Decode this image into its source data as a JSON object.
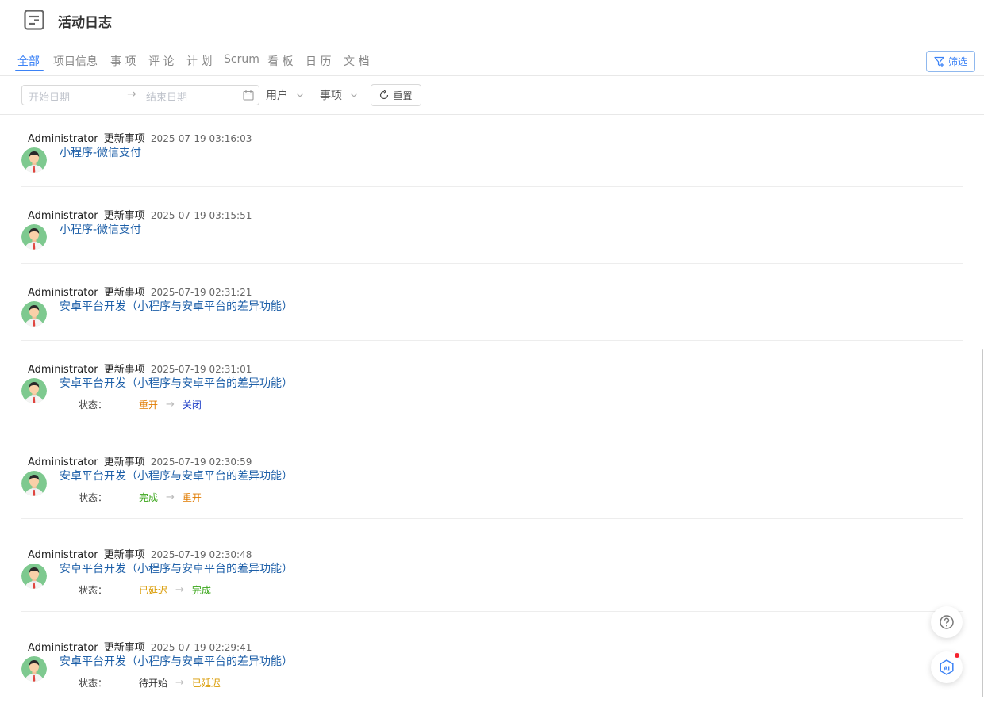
{
  "header": {
    "title": "活动日志"
  },
  "tabs": [
    {
      "label": "全部",
      "active": true
    },
    {
      "label": "项目信息"
    },
    {
      "label": "事 项"
    },
    {
      "label": "评 论"
    },
    {
      "label": "计 划"
    },
    {
      "label": "Scrum"
    },
    {
      "label": "看 板"
    },
    {
      "label": "日 历"
    },
    {
      "label": "文 档"
    }
  ],
  "filter_button": "筛选",
  "toolbar": {
    "start_placeholder": "开始日期",
    "end_placeholder": "结束日期",
    "user_select": "用户",
    "item_select": "事项",
    "reset_label": "重置"
  },
  "colors": {
    "accent": "#3b82f6",
    "link": "#1d5fa8",
    "status_reopen": "#e07b00",
    "status_closed": "#2040c8",
    "status_done": "#3aa61a",
    "status_delayed": "#d99a00",
    "status_pending": "#333333"
  },
  "entries": [
    {
      "user": "Administrator",
      "action": "更新事项",
      "time": "2025-07-19 03:16:03",
      "title": "小程序-微信支付"
    },
    {
      "user": "Administrator",
      "action": "更新事项",
      "time": "2025-07-19 03:15:51",
      "title": "小程序-微信支付"
    },
    {
      "user": "Administrator",
      "action": "更新事项",
      "time": "2025-07-19 02:31:21",
      "title": "安卓平台开发（小程序与安卓平台的差异功能）"
    },
    {
      "user": "Administrator",
      "action": "更新事项",
      "time": "2025-07-19 02:31:01",
      "title": "安卓平台开发（小程序与安卓平台的差异功能）",
      "status_label": "状态：",
      "from": "重开",
      "to": "关闭"
    },
    {
      "user": "Administrator",
      "action": "更新事项",
      "time": "2025-07-19 02:30:59",
      "title": "安卓平台开发（小程序与安卓平台的差异功能）",
      "status_label": "状态：",
      "from": "完成",
      "to": "重开"
    },
    {
      "user": "Administrator",
      "action": "更新事项",
      "time": "2025-07-19 02:30:48",
      "title": "安卓平台开发（小程序与安卓平台的差异功能）",
      "status_label": "状态：",
      "from": "已延迟",
      "to": "完成"
    },
    {
      "user": "Administrator",
      "action": "更新事项",
      "time": "2025-07-19 02:29:41",
      "title": "安卓平台开发（小程序与安卓平台的差异功能）",
      "status_label": "状态：",
      "from": "待开始",
      "to": "已延迟"
    }
  ]
}
